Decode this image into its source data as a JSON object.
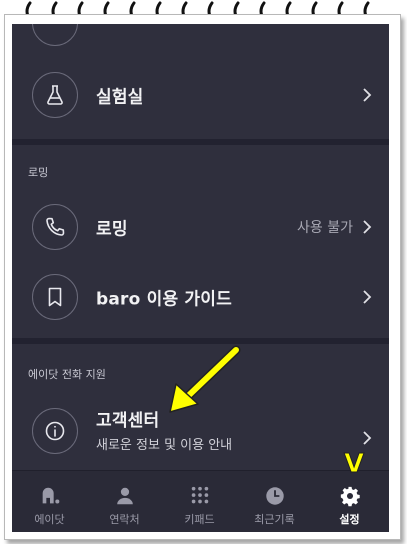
{
  "rows": {
    "lab": {
      "label": "실험실"
    },
    "roaming": {
      "label": "로밍",
      "status": "사용 불가"
    },
    "guide": {
      "label": "baro 이용 가이드"
    },
    "support": {
      "label": "고객센터",
      "sub": "새로운 정보 및 이용 안내"
    }
  },
  "sections": {
    "roaming": "로밍",
    "support": "에이닷 전화 지원"
  },
  "tabs": [
    {
      "label": "에이닷",
      "icon": "adot-logo-icon"
    },
    {
      "label": "연락처",
      "icon": "person-icon"
    },
    {
      "label": "키패드",
      "icon": "keypad-icon"
    },
    {
      "label": "최근기록",
      "icon": "clock-icon"
    },
    {
      "label": "설정",
      "icon": "gear-icon",
      "active": true
    }
  ],
  "annotation": {
    "arrow_color": "#ffff00",
    "check_mark": "V"
  },
  "colors": {
    "screen_bg": "#2f2f3d",
    "text": "#f2f2f4",
    "accent_annotation": "#ffff00"
  }
}
